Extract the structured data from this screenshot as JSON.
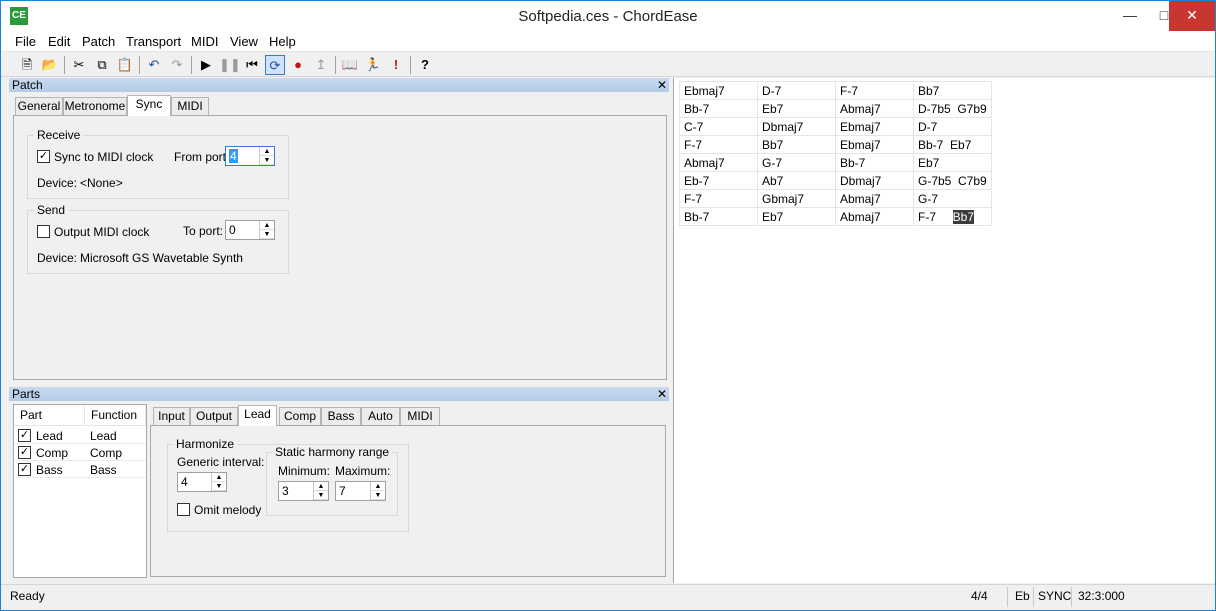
{
  "window": {
    "title": "Softpedia.ces - ChordEase",
    "icon": "ce-app-icon"
  },
  "menu": [
    "File",
    "Edit",
    "Patch",
    "Transport",
    "MIDI",
    "View",
    "Help"
  ],
  "toolbar": {
    "icons": [
      "new-icon",
      "open-icon",
      "cut-icon",
      "copy-icon",
      "paste-icon",
      "undo-icon",
      "redo-icon",
      "play-icon",
      "pause-icon",
      "rewind-icon",
      "loop-icon",
      "record-icon",
      "punch-icon",
      "song-icon",
      "run-icon",
      "alert-icon",
      "help-icon"
    ]
  },
  "patch_pane": {
    "title": "Patch",
    "tabs": [
      "General",
      "Metronome",
      "Sync",
      "MIDI"
    ],
    "active_tab": "Sync",
    "receive": {
      "label": "Receive",
      "sync_label": "Sync to MIDI clock",
      "sync_checked": true,
      "from_port_label": "From port:",
      "from_port_value": "4",
      "device_label": "Device:",
      "device_value": "<None>"
    },
    "send": {
      "label": "Send",
      "output_label": "Output MIDI clock",
      "output_checked": false,
      "to_port_label": "To port:",
      "to_port_value": "0",
      "device_label": "Device:",
      "device_value": "Microsoft GS Wavetable Synth"
    }
  },
  "parts_pane": {
    "title": "Parts",
    "columns": [
      "Part",
      "Function"
    ],
    "rows": [
      {
        "part": "Lead",
        "function": "Lead",
        "checked": true
      },
      {
        "part": "Comp",
        "function": "Comp",
        "checked": true
      },
      {
        "part": "Bass",
        "function": "Bass",
        "checked": true
      }
    ],
    "tabs": [
      "Input",
      "Output",
      "Lead",
      "Comp",
      "Bass",
      "Auto",
      "MIDI"
    ],
    "active_tab": "Lead",
    "harmonize": {
      "label": "Harmonize",
      "generic_interval_label": "Generic interval:",
      "generic_interval_value": "4",
      "static_range_label": "Static harmony range",
      "minimum_label": "Minimum:",
      "minimum_value": "3",
      "maximum_label": "Maximum:",
      "maximum_value": "7",
      "omit_melody_label": "Omit melody",
      "omit_melody_checked": false
    }
  },
  "chart": {
    "rows": [
      [
        "Ebmaj7",
        "D-7",
        "F-7",
        "Bb7"
      ],
      [
        "Bb-7",
        "Eb7",
        "Abmaj7",
        "D-7b5  G7b9"
      ],
      [
        "C-7",
        "Dbmaj7",
        "Ebmaj7",
        "D-7"
      ],
      [
        "F-7",
        "Bb7",
        "Ebmaj7",
        "Bb-7  Eb7"
      ],
      [
        "Abmaj7",
        "G-7",
        "Bb-7",
        "Eb7"
      ],
      [
        "Eb-7",
        "Ab7",
        "Dbmaj7",
        "G-7b5  C7b9"
      ],
      [
        "F-7",
        "Gbmaj7",
        "Abmaj7",
        "G-7"
      ],
      [
        "Bb-7",
        "Eb7",
        "Abmaj7",
        "F-7"
      ]
    ],
    "selected_chord": "Bb7"
  },
  "status": {
    "text": "Ready",
    "meter": "4/4",
    "key": "Eb",
    "sync": "SYNC",
    "position": "32:3:000"
  }
}
